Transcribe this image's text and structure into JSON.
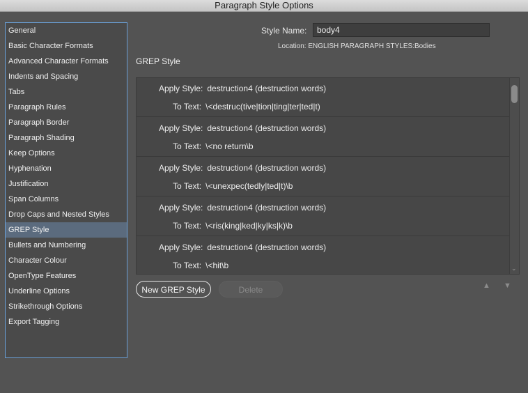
{
  "window": {
    "title": "Paragraph Style Options"
  },
  "sidebar": {
    "items": [
      {
        "label": "General"
      },
      {
        "label": "Basic Character Formats"
      },
      {
        "label": "Advanced Character Formats"
      },
      {
        "label": "Indents and Spacing"
      },
      {
        "label": "Tabs"
      },
      {
        "label": "Paragraph Rules"
      },
      {
        "label": "Paragraph Border"
      },
      {
        "label": "Paragraph Shading"
      },
      {
        "label": "Keep Options"
      },
      {
        "label": "Hyphenation"
      },
      {
        "label": "Justification"
      },
      {
        "label": "Span Columns"
      },
      {
        "label": "Drop Caps and Nested Styles"
      },
      {
        "label": "GREP Style"
      },
      {
        "label": "Bullets and Numbering"
      },
      {
        "label": "Character Colour"
      },
      {
        "label": "OpenType Features"
      },
      {
        "label": "Underline Options"
      },
      {
        "label": "Strikethrough Options"
      },
      {
        "label": "Export Tagging"
      }
    ],
    "selected": "GREP Style"
  },
  "style_name": {
    "label": "Style Name:",
    "value": "body4"
  },
  "location": {
    "text": "Location:  ENGLISH PARAGRAPH STYLES:Bodies"
  },
  "section": {
    "title": "GREP Style"
  },
  "grep": {
    "apply_label": "Apply Style:",
    "to_text_label": "To Text:",
    "entries": [
      {
        "style": "destruction4 (destruction words)",
        "text": "\\<destruc(tive|tion|ting|ter|ted|t)"
      },
      {
        "style": "destruction4 (destruction words)",
        "text": "\\<no return\\b"
      },
      {
        "style": "destruction4 (destruction words)",
        "text": "\\<unexpec(tedly|ted|t)\\b"
      },
      {
        "style": "destruction4 (destruction words)",
        "text": "\\<ris(king|ked|ky|ks|k)\\b"
      },
      {
        "style": "destruction4 (destruction words)",
        "text": "\\<hit\\b"
      }
    ]
  },
  "buttons": {
    "new_grep": "New GREP Style",
    "delete": "Delete"
  },
  "icons": {
    "move_up": "▲",
    "move_down": "▼",
    "scroll_down": "⌄"
  }
}
